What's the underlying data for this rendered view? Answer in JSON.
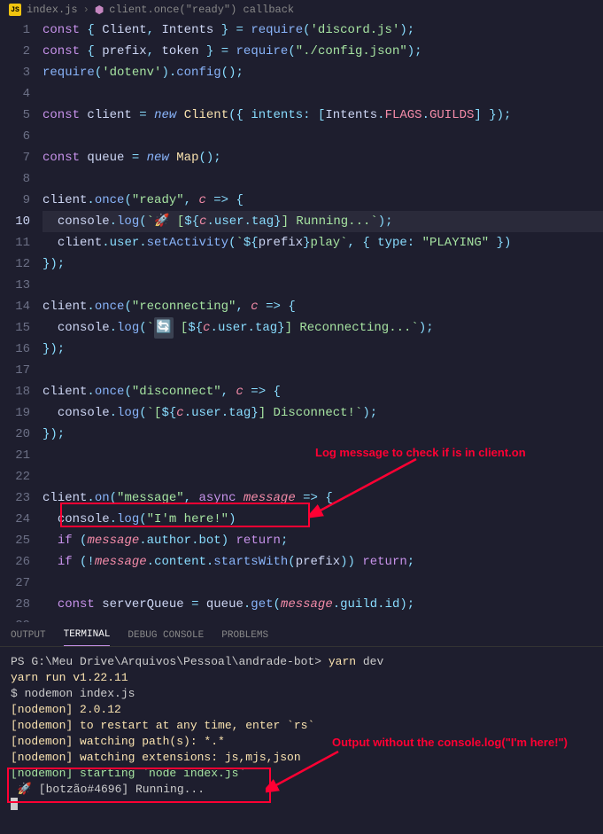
{
  "breadcrumb": {
    "file": "index.js",
    "method": "client.once(\"ready\") callback"
  },
  "code": {
    "lines": [
      {
        "num": 1,
        "html": "<span class='kw'>const</span> <span class='punct'>{</span> <span class='var'>Client</span><span class='punct'>,</span> <span class='var'>Intents</span> <span class='punct'>}</span> <span class='punct'>=</span> <span class='fn'>require</span><span class='punct'>(</span><span class='str'>'discord.js'</span><span class='punct'>);</span>"
      },
      {
        "num": 2,
        "html": "<span class='kw'>const</span> <span class='punct'>{</span> <span class='var'>prefix</span><span class='punct'>,</span> <span class='var'>token</span> <span class='punct'>}</span> <span class='punct'>=</span> <span class='fn'>require</span><span class='punct'>(</span><span class='str'>\"./config.json\"</span><span class='punct'>);</span>"
      },
      {
        "num": 3,
        "html": "<span class='fn'>require</span><span class='punct'>(</span><span class='str'>'dotenv'</span><span class='punct'>).</span><span class='fn'>config</span><span class='punct'>();</span>"
      },
      {
        "num": 4,
        "html": ""
      },
      {
        "num": 5,
        "html": "<span class='kw'>const</span> <span class='var'>client</span> <span class='punct'>=</span> <span class='new'>new</span> <span class='type'>Client</span><span class='punct'>({</span> <span class='prop'>intents</span><span class='punct'>:</span> <span class='punct'>[</span><span class='var'>Intents</span><span class='punct'>.</span><span class='const-c'>FLAGS</span><span class='punct'>.</span><span class='const-c'>GUILDS</span><span class='punct'>]</span> <span class='punct'>});</span>"
      },
      {
        "num": 6,
        "html": ""
      },
      {
        "num": 7,
        "html": "<span class='kw'>const</span> <span class='var'>queue</span> <span class='punct'>=</span> <span class='new'>new</span> <span class='type'>Map</span><span class='punct'>();</span>"
      },
      {
        "num": 8,
        "html": ""
      },
      {
        "num": 9,
        "html": "<span class='var'>client</span><span class='punct'>.</span><span class='fn'>once</span><span class='punct'>(</span><span class='str'>\"ready\"</span><span class='punct'>,</span> <span class='param'>c</span> <span class='punct'>=&gt;</span> <span class='punct'>{</span>"
      },
      {
        "num": 10,
        "active": true,
        "html": "  <span class='var'>console</span><span class='punct'>.</span><span class='fn'>log</span><span class='punct'>(</span><span class='str'>`🚀 [</span><span class='punct'>${</span><span class='param'>c</span><span class='punct'>.</span><span class='prop'>user</span><span class='punct'>.</span><span class='prop'>tag</span><span class='punct'>}</span><span class='str'>] Running...`</span><span class='punct'>);</span>"
      },
      {
        "num": 11,
        "html": "  <span class='var'>client</span><span class='punct'>.</span><span class='prop'>user</span><span class='punct'>.</span><span class='fn'>setActivity</span><span class='punct'>(</span><span class='str'>`</span><span class='punct'>${</span><span class='var'>prefix</span><span class='punct'>}</span><span class='str'>play`</span><span class='punct'>,</span> <span class='punct'>{</span> <span class='prop'>type</span><span class='punct'>:</span> <span class='str'>\"PLAYING\"</span> <span class='punct'>})</span>"
      },
      {
        "num": 12,
        "html": "<span class='punct'>});</span>"
      },
      {
        "num": 13,
        "html": ""
      },
      {
        "num": 14,
        "html": "<span class='var'>client</span><span class='punct'>.</span><span class='fn'>once</span><span class='punct'>(</span><span class='str'>\"reconnecting\"</span><span class='punct'>,</span> <span class='param'>c</span> <span class='punct'>=&gt;</span> <span class='punct'>{</span>"
      },
      {
        "num": 15,
        "html": "  <span class='var'>console</span><span class='punct'>.</span><span class='fn'>log</span><span class='punct'>(</span><span class='str'>`<span class='strbox'>🔄</span> [</span><span class='punct'>${</span><span class='param'>c</span><span class='punct'>.</span><span class='prop'>user</span><span class='punct'>.</span><span class='prop'>tag</span><span class='punct'>}</span><span class='str'>] Reconnecting...`</span><span class='punct'>);</span>"
      },
      {
        "num": 16,
        "html": "<span class='punct'>});</span>"
      },
      {
        "num": 17,
        "html": ""
      },
      {
        "num": 18,
        "html": "<span class='var'>client</span><span class='punct'>.</span><span class='fn'>once</span><span class='punct'>(</span><span class='str'>\"disconnect\"</span><span class='punct'>,</span> <span class='param'>c</span> <span class='punct'>=&gt;</span> <span class='punct'>{</span>"
      },
      {
        "num": 19,
        "html": "  <span class='var'>console</span><span class='punct'>.</span><span class='fn'>log</span><span class='punct'>(</span><span class='str'>`[</span><span class='punct'>${</span><span class='param'>c</span><span class='punct'>.</span><span class='prop'>user</span><span class='punct'>.</span><span class='prop'>tag</span><span class='punct'>}</span><span class='str'>] Disconnect!`</span><span class='punct'>);</span>"
      },
      {
        "num": 20,
        "html": "<span class='punct'>});</span>"
      },
      {
        "num": 21,
        "html": ""
      },
      {
        "num": 22,
        "html": ""
      },
      {
        "num": 23,
        "html": "<span class='var'>client</span><span class='punct'>.</span><span class='fn'>on</span><span class='punct'>(</span><span class='str'>\"message\"</span><span class='punct'>,</span> <span class='kw'>async</span> <span class='param'>message</span> <span class='punct'>=&gt;</span> <span class='punct'>{</span>"
      },
      {
        "num": 24,
        "html": "  <span class='var'>console</span><span class='punct'>.</span><span class='fn'>log</span><span class='punct'>(</span><span class='str'>\"I'm here!\"</span><span class='punct'>)</span>"
      },
      {
        "num": 25,
        "html": "  <span class='kw'>if</span> <span class='punct'>(</span><span class='param'>message</span><span class='punct'>.</span><span class='prop'>author</span><span class='punct'>.</span><span class='prop'>bot</span><span class='punct'>)</span> <span class='kw'>return</span><span class='punct'>;</span>"
      },
      {
        "num": 26,
        "html": "  <span class='kw'>if</span> <span class='punct'>(!</span><span class='param'>message</span><span class='punct'>.</span><span class='prop'>content</span><span class='punct'>.</span><span class='fn'>startsWith</span><span class='punct'>(</span><span class='var'>prefix</span><span class='punct'>))</span> <span class='kw'>return</span><span class='punct'>;</span>"
      },
      {
        "num": 27,
        "html": ""
      },
      {
        "num": 28,
        "html": "  <span class='kw'>const</span> <span class='var'>serverQueue</span> <span class='punct'>=</span> <span class='var'>queue</span><span class='punct'>.</span><span class='fn'>get</span><span class='punct'>(</span><span class='param'>message</span><span class='punct'>.</span><span class='prop'>guild</span><span class='punct'>.</span><span class='prop'>id</span><span class='punct'>);</span>"
      }
    ]
  },
  "panelTabs": {
    "output": "OUTPUT",
    "terminal": "TERMINAL",
    "debug": "DEBUG CONSOLE",
    "problems": "PROBLEMS"
  },
  "terminal": {
    "lines": [
      {
        "cls": "",
        "text": "PS G:\\Meu Drive\\Arquivos\\Pessoal\\andrade-bot> yarn dev"
      },
      {
        "cls": "cmd",
        "text": "yarn run v1.22.11"
      },
      {
        "cls": "",
        "text": "$ nodemon index.js"
      },
      {
        "cls": "nd",
        "text": "[nodemon] 2.0.12"
      },
      {
        "cls": "nd",
        "text": "[nodemon] to restart at any time, enter `rs`"
      },
      {
        "cls": "nd",
        "text": "[nodemon] watching path(s): *.*"
      },
      {
        "cls": "nd",
        "text": "[nodemon] watching extensions: js,mjs,json"
      },
      {
        "cls": "nd-green",
        "text": "[nodemon] starting `node index.js`"
      },
      {
        "cls": "",
        "text": " 🚀 [botzão#4696] Running..."
      }
    ]
  },
  "annotations": {
    "top": "Log message to check if is in client.on",
    "bottom": "Output without the console.log(\"I'm here!\")"
  }
}
